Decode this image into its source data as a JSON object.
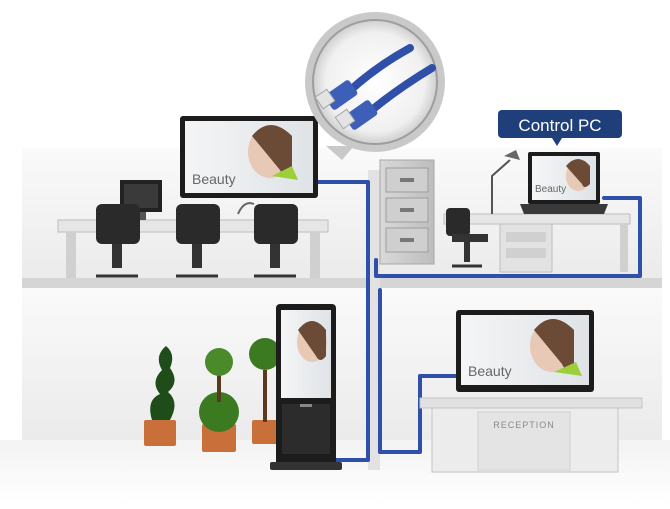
{
  "callout": {
    "label": "Control PC"
  },
  "screens": {
    "office_monitor": "Beauty",
    "control_pc_monitor": "Beauty",
    "reception_monitor": "Beauty"
  },
  "reception_desk": {
    "label": "RECEPTION"
  },
  "colors": {
    "cable": "#2f4fa8",
    "callout_bg": "#1f3f7a",
    "callout_text": "#ffffff",
    "wall": "#f2f2f2",
    "floor": "#eeeeee",
    "screen_bg": "#e9ecef"
  }
}
